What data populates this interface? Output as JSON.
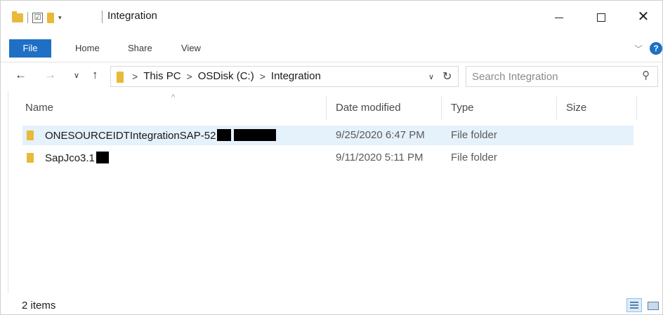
{
  "window": {
    "title": "Integration",
    "qat_check": "☑",
    "qat_dropdown": "▾",
    "minimize": "",
    "maximize": "",
    "close": "✕"
  },
  "ribbon": {
    "tabs": [
      {
        "label": "File",
        "active": true
      },
      {
        "label": "Home"
      },
      {
        "label": "Share"
      },
      {
        "label": "View"
      }
    ],
    "help": "?",
    "expand": "﹀"
  },
  "nav": {
    "back": "←",
    "forward": "→",
    "recent": "∨",
    "up": "↑",
    "breadcrumbs": [
      "This PC",
      "OSDisk (C:)",
      "Integration"
    ],
    "breadcrumb_sep": ">",
    "dropdown": "∨",
    "refresh": "↻"
  },
  "search": {
    "placeholder": "Search Integration"
  },
  "columns": {
    "name": "Name",
    "date": "Date modified",
    "type": "Type",
    "size": "Size",
    "sort_caret": "^"
  },
  "rows": [
    {
      "name": "ONESOURCEIDTIntegrationSAP-52",
      "date": "9/25/2020 6:47 PM",
      "type": "File folder",
      "selected": true
    },
    {
      "name": "SapJco3.1",
      "date": "9/11/2020 5:11 PM",
      "type": "File folder",
      "selected": false
    }
  ],
  "status": {
    "items_text": "2 items"
  },
  "colors": {
    "accent": "#1f6fc5",
    "folder": "#e8b93a",
    "selection": "#e5f1fb"
  }
}
